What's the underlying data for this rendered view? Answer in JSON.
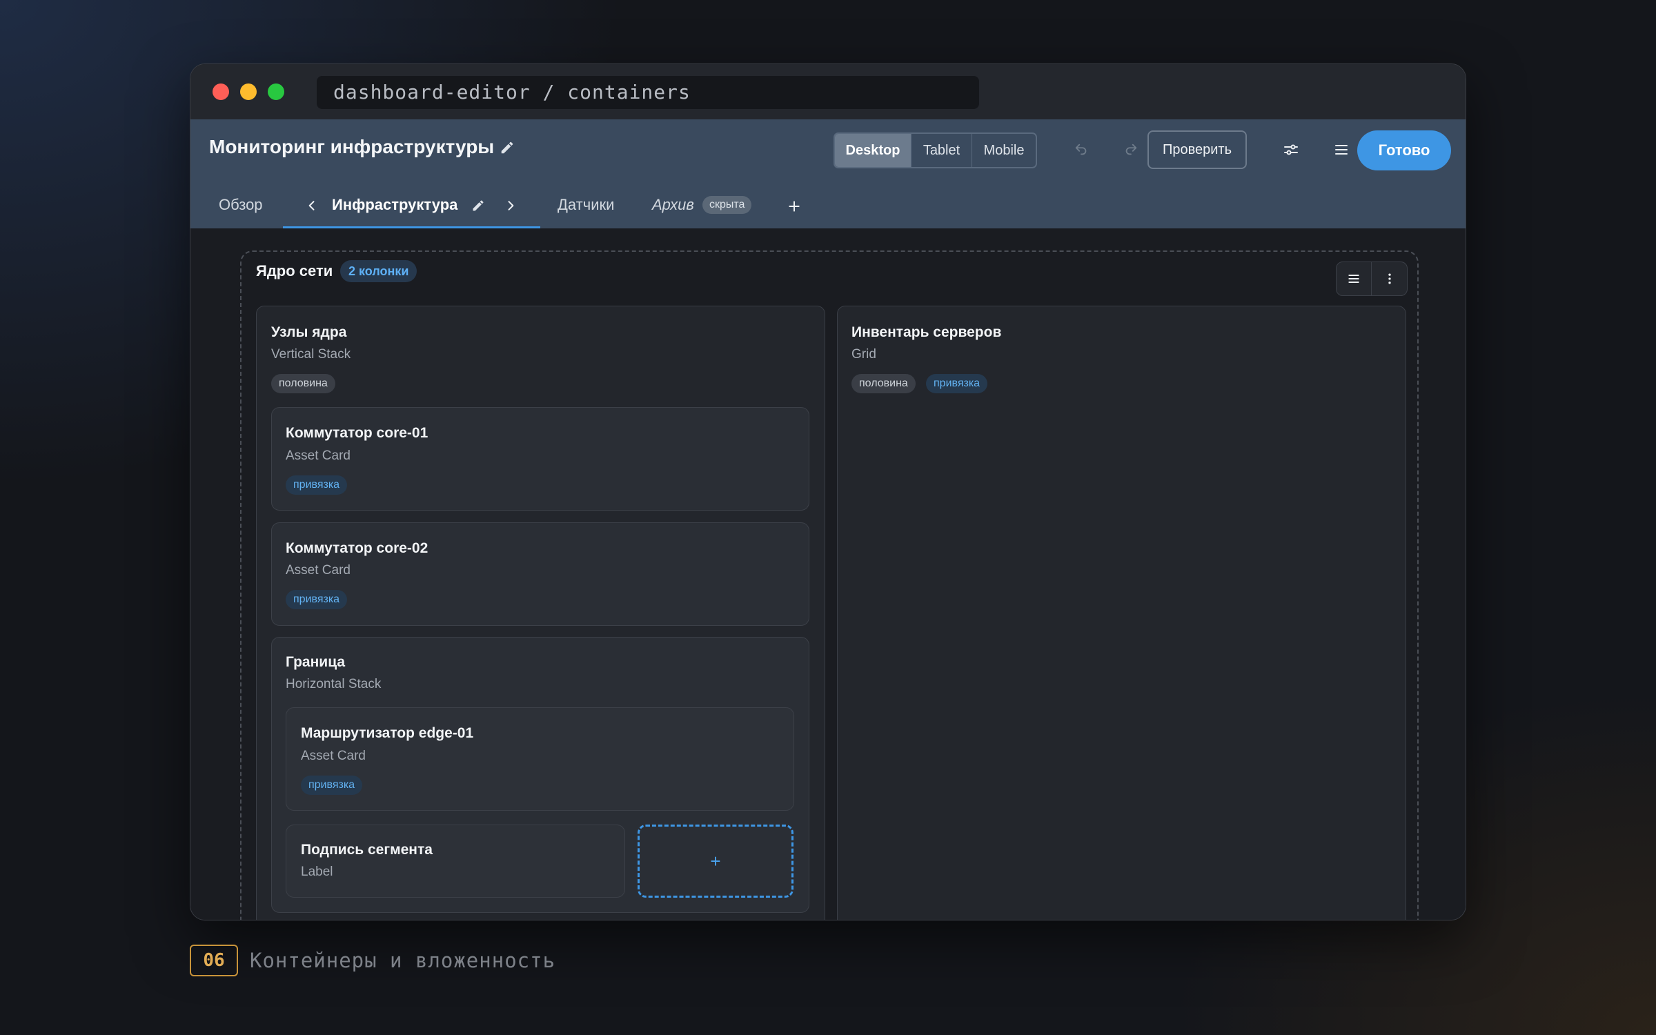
{
  "window": {
    "address": "dashboard-editor / containers"
  },
  "toolbar": {
    "title": "Мониторинг инфраструктуры",
    "views": [
      "Desktop",
      "Tablet",
      "Mobile"
    ],
    "selected_view": "Desktop",
    "check_label": "Проверить",
    "done_label": "Готово"
  },
  "tabs": [
    {
      "label": "Обзор"
    },
    {
      "label": "Инфраструктура",
      "active": true
    },
    {
      "label": "Датчики"
    },
    {
      "label": "Архив",
      "badge": "скрыта"
    }
  ],
  "section": {
    "title": "Ядро сети",
    "badge": "2 колонки",
    "left": {
      "title": "Узлы ядра",
      "type": "Vertical Stack",
      "tags": [
        "половина"
      ],
      "children": [
        {
          "title": "Коммутатор core-01",
          "type": "Asset Card",
          "tag": "привязка"
        },
        {
          "title": "Коммутатор core-02",
          "type": "Asset Card",
          "tag": "привязка"
        },
        {
          "title": "Граница",
          "type": "Horizontal Stack",
          "children": [
            {
              "title": "Маршрутизатор edge-01",
              "type": "Asset Card",
              "tag": "привязка"
            },
            {
              "title": "Подпись сегмента",
              "type": "Label"
            }
          ],
          "add_label": "+"
        }
      ]
    },
    "right": {
      "title": "Инвентарь серверов",
      "type": "Grid",
      "tags": [
        "половина",
        "привязка"
      ]
    }
  },
  "caption": {
    "number": "06",
    "text": "Контейнеры и вложенность"
  },
  "colors": {
    "accent": "#3e96e4",
    "toolbar": "#3a4a5e",
    "caption_accent": "#c9943a"
  }
}
